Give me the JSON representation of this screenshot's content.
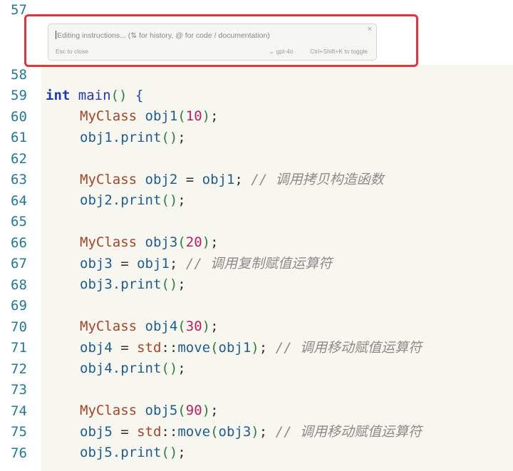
{
  "inline_chat": {
    "placeholder": "Editing instructions... (⇅ for history, @ for code / documentation)",
    "close_glyph": "×",
    "esc_hint": "Esc to close",
    "model": "⌄ gpt-4o",
    "toggle_hint": "Ctrl+Shift+K to toggle"
  },
  "lines": [
    {
      "n": "57"
    },
    {
      "n": "58"
    },
    {
      "n": "59"
    },
    {
      "n": "60"
    },
    {
      "n": "61"
    },
    {
      "n": "62"
    },
    {
      "n": "63"
    },
    {
      "n": "64"
    },
    {
      "n": "65"
    },
    {
      "n": "66"
    },
    {
      "n": "67"
    },
    {
      "n": "68"
    },
    {
      "n": "69"
    },
    {
      "n": "70"
    },
    {
      "n": "71"
    },
    {
      "n": "72"
    },
    {
      "n": "73"
    },
    {
      "n": "74"
    },
    {
      "n": "75"
    },
    {
      "n": "76"
    }
  ],
  "code": {
    "l58": {
      "kw": "int",
      "fn": "main",
      "p": "()",
      "b": "{"
    },
    "l59": {
      "ty": "MyClass",
      "id": "obj1",
      "po": "(",
      "num": "10",
      "pc": ")",
      "end": ";"
    },
    "l60": {
      "id": "obj1.print",
      "p": "()",
      "end": ";"
    },
    "l62": {
      "ty": "MyClass",
      "id": "obj2",
      "op": " = ",
      "id2": "obj1",
      "end": ";",
      "cm": "// 调用拷贝构造函数"
    },
    "l63": {
      "id": "obj2.print",
      "p": "()",
      "end": ";"
    },
    "l65": {
      "ty": "MyClass",
      "id": "obj3",
      "po": "(",
      "num": "20",
      "pc": ")",
      "end": ";"
    },
    "l66": {
      "id": "obj3",
      "op": " = ",
      "id2": "obj1",
      "end": ";",
      "cm": "// 调用复制赋值运算符"
    },
    "l67": {
      "id": "obj3.print",
      "p": "()",
      "end": ";"
    },
    "l69": {
      "ty": "MyClass",
      "id": "obj4",
      "po": "(",
      "num": "30",
      "pc": ")",
      "end": ";"
    },
    "l70": {
      "id": "obj4",
      "op": " = ",
      "ns": "std",
      "sep": "::",
      "fn": "move",
      "po": "(",
      "arg": "obj1",
      "pc": ")",
      "end": ";",
      "cm": "// 调用移动赋值运算符"
    },
    "l71": {
      "id": "obj4.print",
      "p": "()",
      "end": ";"
    },
    "l73": {
      "ty": "MyClass",
      "id": "obj5",
      "po": "(",
      "num": "90",
      "pc": ")",
      "end": ";"
    },
    "l74": {
      "id": "obj5",
      "op": " = ",
      "ns": "std",
      "sep": "::",
      "fn": "move",
      "po": "(",
      "arg": "obj3",
      "pc": ")",
      "end": ";",
      "cm": "// 调用移动赋值运算符"
    },
    "l75": {
      "id": "obj5.print",
      "p": "()",
      "end": ";"
    }
  }
}
